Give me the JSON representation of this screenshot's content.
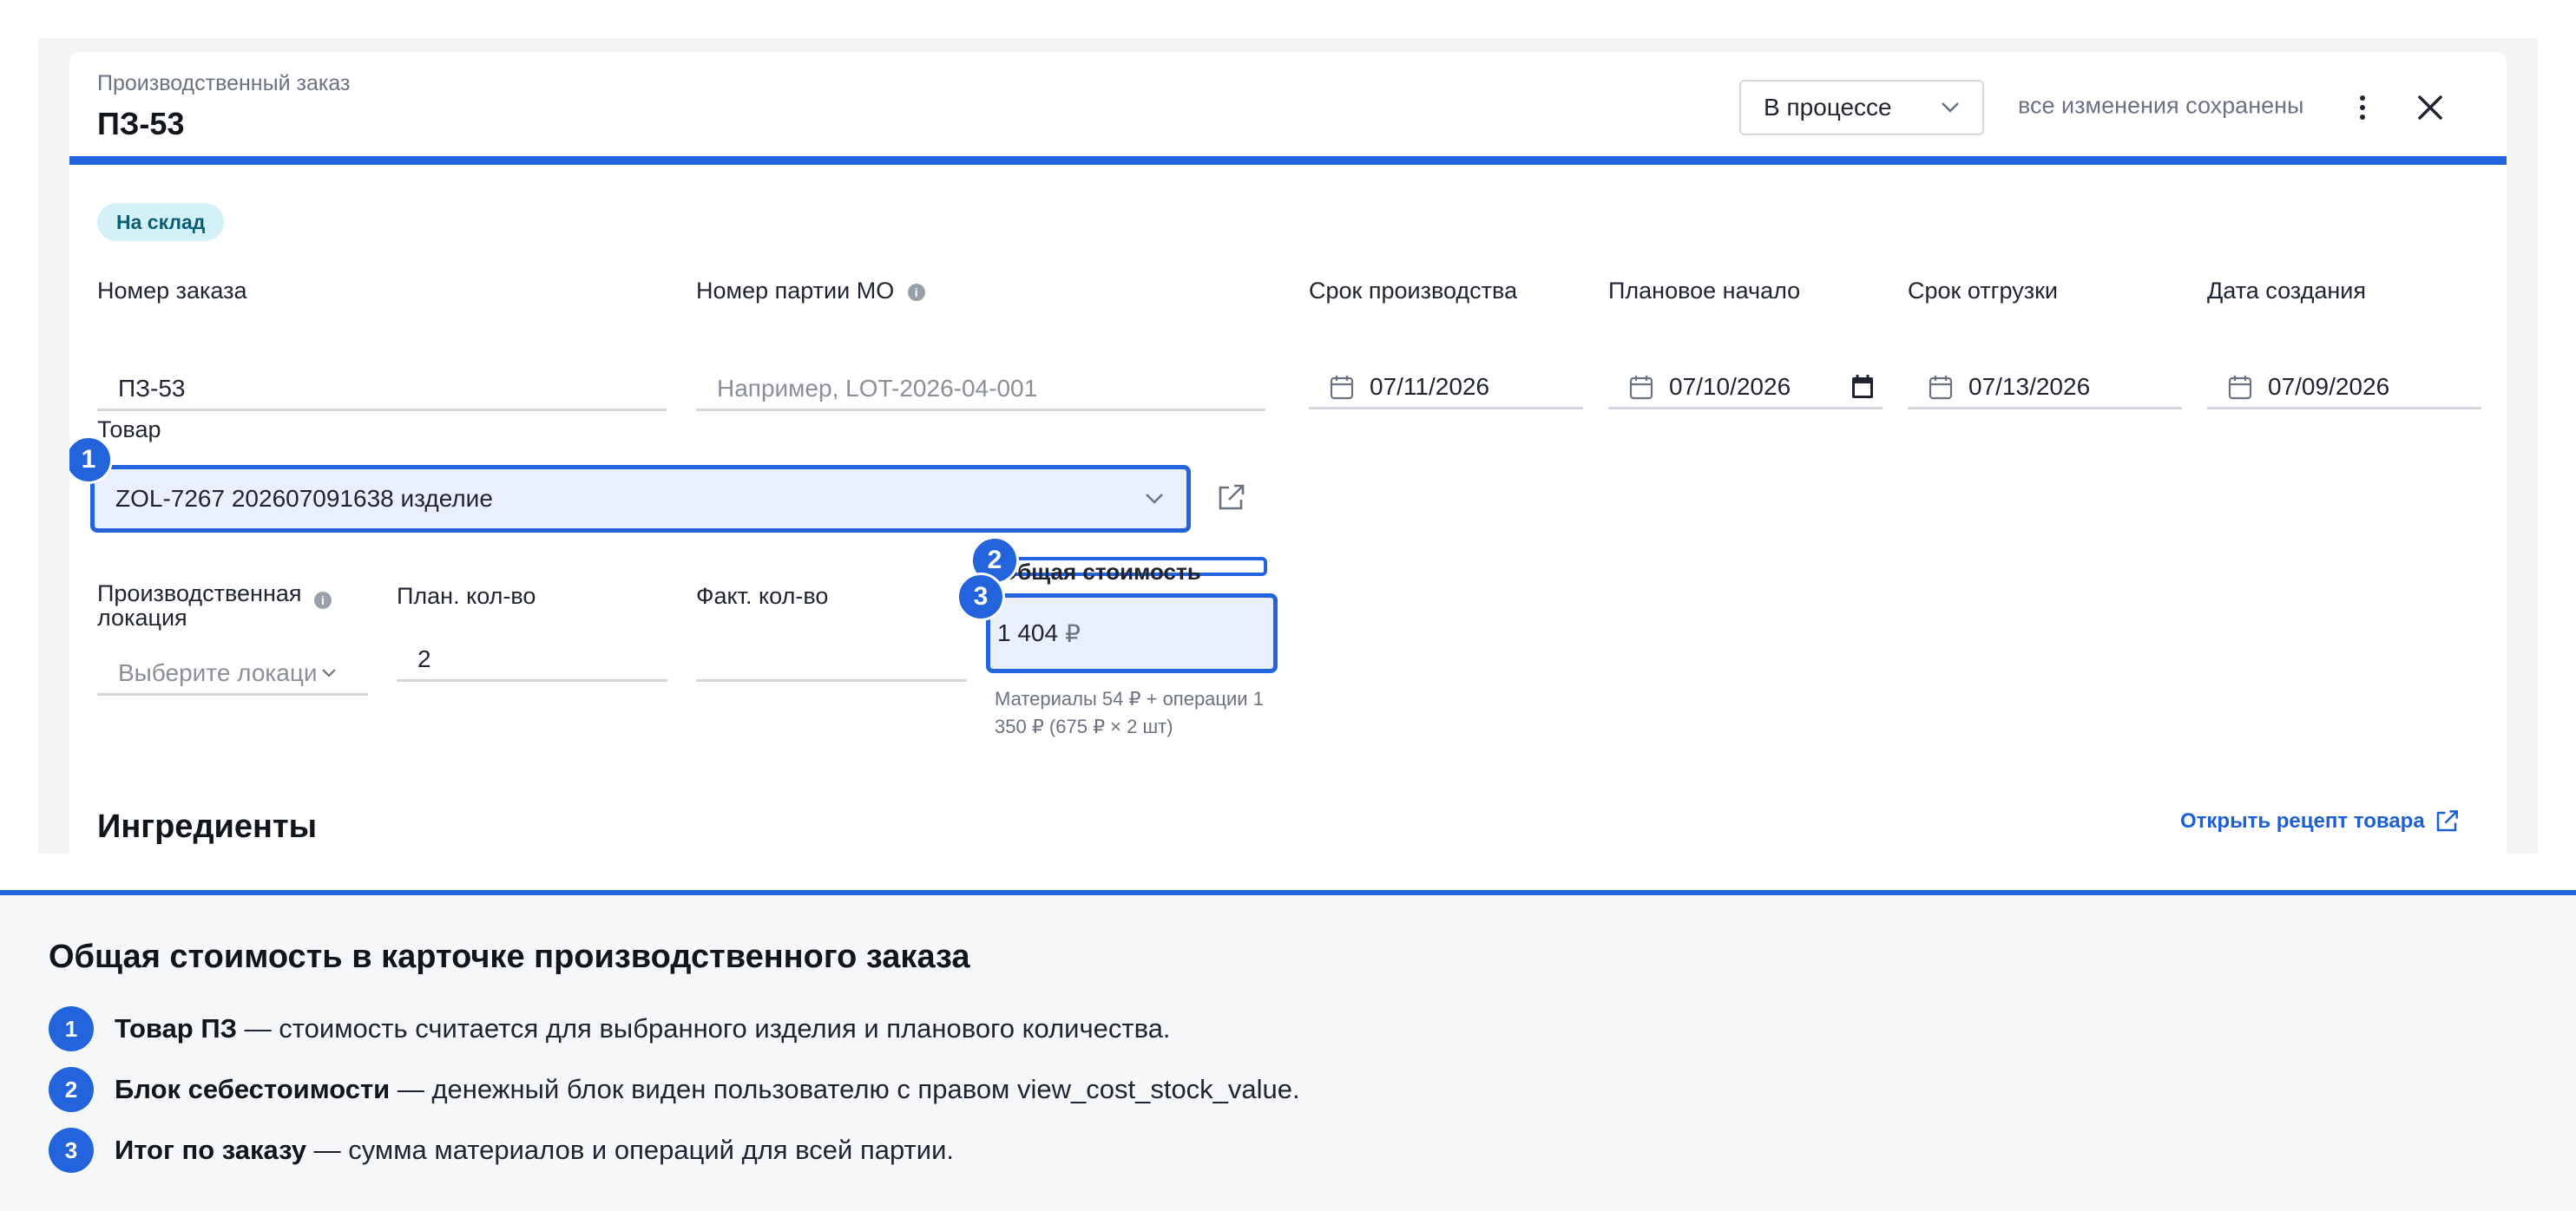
{
  "header": {
    "subtitle": "Производственный заказ",
    "title": "ПЗ-53",
    "status_value": "В процессе",
    "saved_text": "все изменения сохранены"
  },
  "badge": "На склад",
  "fields": {
    "order_number": {
      "label": "Номер заказа",
      "value": "ПЗ-53"
    },
    "batch_number": {
      "label": "Номер партии МО",
      "placeholder": "Например, LOT-2026-04-001"
    },
    "production_deadline": {
      "label": "Срок производства",
      "value": "07/11/2026"
    },
    "planned_start": {
      "label": "Плановое начало",
      "value": "07/10/2026"
    },
    "shipping_deadline": {
      "label": "Срок отгрузки",
      "value": "07/13/2026"
    },
    "created_date": {
      "label": "Дата создания",
      "value": "07/09/2026"
    },
    "product": {
      "label": "Товар",
      "value": "ZOL-7267 202607091638 изделие"
    },
    "location": {
      "label": "Производственная локация",
      "placeholder": "Выберите локаци"
    },
    "planned_qty": {
      "label": "План. кол-во",
      "value": "2"
    },
    "actual_qty": {
      "label": "Факт. кол-во",
      "value": ""
    },
    "total_cost": {
      "label": "Общая стоимость",
      "amount": "1 404",
      "currency": "₽",
      "note": "Материалы 54 ₽ + операции 1 350 ₽ (675 ₽ × 2 шт)"
    }
  },
  "markers": [
    "1",
    "2",
    "3"
  ],
  "ingredients": {
    "title": "Ингредиенты",
    "recipe_link": "Открыть рецепт товара"
  },
  "caption": {
    "title": "Общая стоимость в карточке производственного заказа",
    "items": [
      {
        "num": "1",
        "bold": "Товар ПЗ",
        "text": " — стоимость считается для выбранного изделия и планового количества."
      },
      {
        "num": "2",
        "bold": "Блок себестоимости",
        "text": " — денежный блок виден пользователю с правом view_cost_stock_value."
      },
      {
        "num": "3",
        "bold": "Итог по заказу",
        "text": " — сумма материалов и операций для всей партии."
      }
    ]
  },
  "colors": {
    "accent": "#2364dc",
    "badge_bg": "#d4f1f8",
    "badge_text": "#0b5f74",
    "link": "#1d5fd6"
  }
}
